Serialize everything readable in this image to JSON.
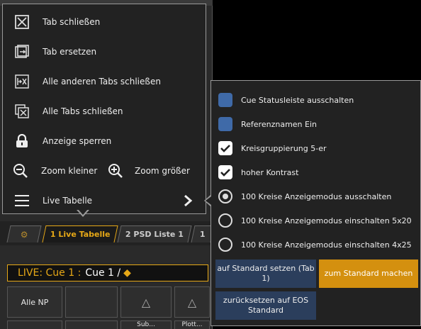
{
  "left_menu": {
    "items": [
      {
        "label": "Tab schließen",
        "icon": "close-box-icon"
      },
      {
        "label": "Tab ersetzen",
        "icon": "replace-icon"
      },
      {
        "label": "Alle anderen Tabs schließen",
        "icon": "close-others-icon"
      },
      {
        "label": "Alle Tabs schließen",
        "icon": "close-all-icon"
      },
      {
        "label": "Anzeige sperren",
        "icon": "lock-icon"
      }
    ],
    "zoom_out": "Zoom kleiner",
    "zoom_in": "Zoom größer",
    "live_table": "Live Tabelle"
  },
  "right_menu": {
    "items": [
      {
        "label": "Cue Statusleiste ausschalten",
        "control": "checkbox",
        "checked": false
      },
      {
        "label": "Referenznamen Ein",
        "control": "checkbox",
        "checked": false
      },
      {
        "label": "Kreisgruppierung 5-er",
        "control": "checkbox",
        "checked": true
      },
      {
        "label": "hoher Kontrast",
        "control": "checkbox",
        "checked": true
      },
      {
        "label": "100 Kreise Anzeigemodus ausschalten",
        "control": "radio",
        "checked": true
      },
      {
        "label": "100 Kreise Anzeigemodus einschalten 5x20",
        "control": "radio",
        "checked": false
      },
      {
        "label": "100 Kreise Anzeigemodus einschalten 4x25",
        "control": "radio",
        "checked": false
      }
    ],
    "btn_set_default": "auf Standard setzen (Tab 1)",
    "btn_make_default": "zum Standard machen",
    "btn_reset_eos": "zurücksetzen auf EOS Standard"
  },
  "tabs": [
    {
      "label": "1 Live Tabelle",
      "active": true
    },
    {
      "label": "2 PSD Liste 1",
      "active": false
    },
    {
      "label": "1",
      "active": false
    }
  ],
  "cue_bar": {
    "prefix": "LIVE: Cue  1 :",
    "cue": "Cue 1 /",
    "diamond": "◆"
  },
  "grid": {
    "row1": [
      "Alle NP",
      "",
      "△",
      "△"
    ],
    "row2": [
      "",
      "",
      "Sub...",
      "Plott..."
    ]
  },
  "colors": {
    "accent": "#e6a817",
    "checkbox_off": "#3f6aa8",
    "button_blue": "#2b3e5c",
    "button_orange": "#d4900f"
  }
}
